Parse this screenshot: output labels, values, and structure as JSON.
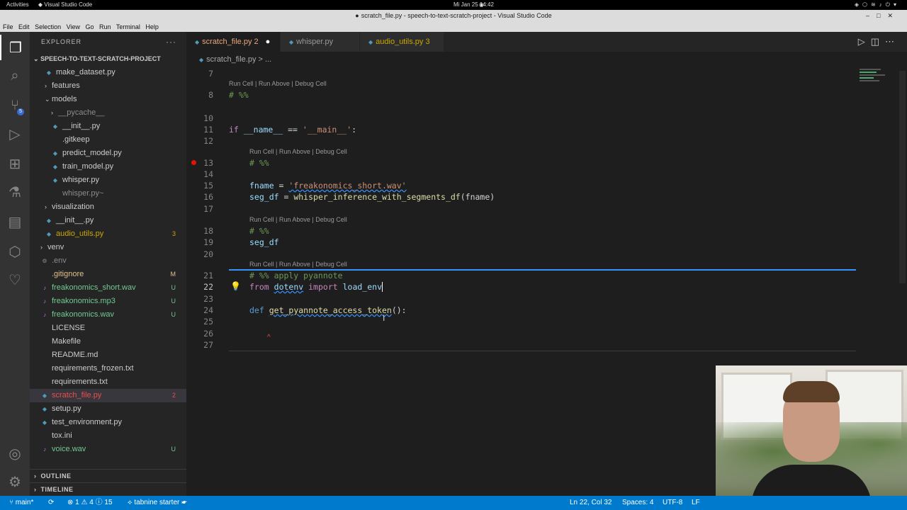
{
  "topbar": {
    "activities": "Activities",
    "app": "Visual Studio Code",
    "clock": "Mi Jan 25  14:42"
  },
  "window": {
    "title": "scratch_file.py - speech-to-text-scratch-project - Visual Studio Code"
  },
  "menu": [
    "File",
    "Edit",
    "Selection",
    "View",
    "Go",
    "Run",
    "Terminal",
    "Help"
  ],
  "activity_bar": {
    "scm_badge": "5",
    "icons": [
      "files-icon",
      "search-icon",
      "source-control-icon",
      "run-debug-icon",
      "extensions-icon",
      "testing-icon",
      "jupyter-icon",
      "remote-icon",
      "tabnine-icon",
      "account-icon",
      "settings-gear-icon"
    ]
  },
  "sidebar": {
    "header": "EXPLORER",
    "more": "···",
    "project": "SPEECH-TO-TEXT-SCRATCH-PROJECT",
    "tree": [
      {
        "label": "make_dataset.py",
        "status": "",
        "color": "#cccccc"
      },
      {
        "label": "features",
        "status": "",
        "color": "#cccccc"
      },
      {
        "label": "models",
        "status": "",
        "color": "#cccccc"
      },
      {
        "label": "__pycache__",
        "status": "",
        "color": "#8b8b8b"
      },
      {
        "label": "__init__.py",
        "status": "",
        "color": "#cccccc"
      },
      {
        "label": ".gitkeep",
        "status": "",
        "color": "#cccccc"
      },
      {
        "label": "predict_model.py",
        "status": "",
        "color": "#cccccc"
      },
      {
        "label": "train_model.py",
        "status": "",
        "color": "#cccccc"
      },
      {
        "label": "whisper.py",
        "status": "",
        "color": "#cccccc"
      },
      {
        "label": "whisper.py~",
        "status": "",
        "color": "#8b8b8b"
      },
      {
        "label": "visualization",
        "status": "",
        "color": "#cccccc"
      },
      {
        "label": "__init__.py",
        "status": "",
        "color": "#cccccc"
      },
      {
        "label": "audio_utils.py",
        "status": "3",
        "color": "#cca700"
      },
      {
        "label": "venv",
        "status": "",
        "color": "#cccccc"
      },
      {
        "label": ".env",
        "status": "",
        "color": "#8b8b8b"
      },
      {
        "label": ".gitignore",
        "status": "M",
        "color": "#e2c08d"
      },
      {
        "label": "freakonomics_short.wav",
        "status": "U",
        "color": "#73c991"
      },
      {
        "label": "freakonomics.mp3",
        "status": "U",
        "color": "#73c991"
      },
      {
        "label": "freakonomics.wav",
        "status": "U",
        "color": "#73c991"
      },
      {
        "label": "LICENSE",
        "status": "",
        "color": "#cccccc"
      },
      {
        "label": "Makefile",
        "status": "",
        "color": "#cccccc"
      },
      {
        "label": "README.md",
        "status": "",
        "color": "#cccccc"
      },
      {
        "label": "requirements_frozen.txt",
        "status": "",
        "color": "#cccccc"
      },
      {
        "label": "requirements.txt",
        "status": "",
        "color": "#cccccc"
      },
      {
        "label": "scratch_file.py",
        "status": "2",
        "color": "#f14c4c"
      },
      {
        "label": "setup.py",
        "status": "",
        "color": "#cccccc"
      },
      {
        "label": "test_environment.py",
        "status": "",
        "color": "#cccccc"
      },
      {
        "label": "tox.ini",
        "status": "",
        "color": "#cccccc"
      },
      {
        "label": "voice.wav",
        "status": "U",
        "color": "#73c991"
      }
    ],
    "outline": "OUTLINE",
    "timeline": "TIMELINE"
  },
  "tabs": [
    {
      "label": "scratch_file.py",
      "badge": "2"
    },
    {
      "label": "whisper.py",
      "badge": ""
    },
    {
      "label": "audio_utils.py",
      "badge": "3"
    }
  ],
  "breadcrumb": {
    "file": "scratch_file.py",
    "sep": ">",
    "more": "..."
  },
  "editor": {
    "codelens": "Run Cell | Run Above | Debug Cell",
    "line_numbers": [
      "7",
      "8",
      "10",
      "11",
      "12",
      "13",
      "14",
      "15",
      "16",
      "17",
      "18",
      "19",
      "20",
      "21",
      "22",
      "23",
      "24",
      "25",
      "26",
      "27"
    ],
    "lines": {
      "l8": "# %%",
      "l11_if": "if",
      "l11_name": "__name__",
      "l11_eq": " == ",
      "l11_str": "'__main__'",
      "l11_colon": ":",
      "l13": "# %%",
      "l15_var": "fname",
      "l15_eq": " = ",
      "l15_str": "'freakonomics_short.wav'",
      "l16_var": "seg_df",
      "l16_eq": " = ",
      "l16_fn": "whisper_inference_with_segments_df",
      "l16_arg": "(fname)",
      "l18": "# %%",
      "l19": "seg_df",
      "l21": "# %% apply pyannote",
      "l22_from": "from",
      "l22_mod": "dotenv",
      "l22_import": "import",
      "l22_name": "load_env",
      "l24_def": "def",
      "l24_fn": "get_pyannote_access_token",
      "l24_rest": "():"
    }
  },
  "statusbar": {
    "branch": "main*",
    "errors": "1",
    "warnings": "4",
    "info": "15",
    "tabnine": "tabnine starter",
    "position": "Ln 22, Col 32",
    "spaces": "Spaces: 4",
    "encoding": "UTF-8",
    "eol": "LF"
  }
}
